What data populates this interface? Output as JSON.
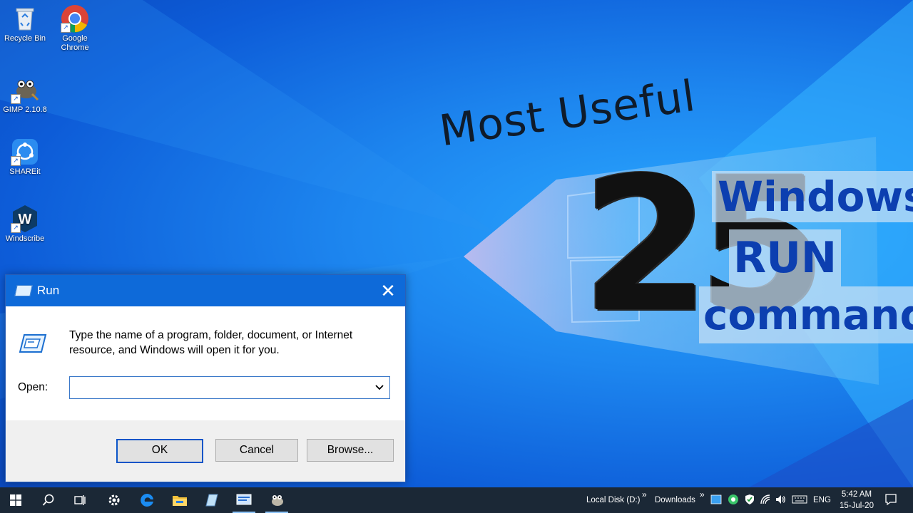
{
  "desktop": {
    "icons": [
      {
        "label": "Recycle Bin"
      },
      {
        "label": "Google Chrome"
      },
      {
        "label": "GIMP 2.10.8"
      },
      {
        "label": "SHAREit"
      },
      {
        "label": "Windscribe"
      }
    ]
  },
  "thumbnail": {
    "headline": "Most Useful",
    "number": "25",
    "line1": "Windows",
    "line2": "RUN",
    "line3": "commands"
  },
  "run_dialog": {
    "title": "Run",
    "close_glyph": "✕",
    "description": "Type the name of a program, folder, document, or Internet resource, and Windows will open it for you.",
    "open_label": "Open:",
    "open_value": "",
    "ok_label": "OK",
    "cancel_label": "Cancel",
    "browse_label": "Browse..."
  },
  "taskbar": {
    "pinned": [
      "windows-start-icon",
      "search-icon",
      "task-view-icon",
      "settings-gear-icon",
      "edge-icon",
      "file-explorer-icon",
      "notepad-icon",
      "run-app-icon",
      "gimp-icon"
    ],
    "toolbar_local_disk": "Local Disk (D:)",
    "toolbar_downloads": "Downloads",
    "chevron": "»",
    "language": "ENG",
    "time": "5:42 AM",
    "date": "15-Jul-20"
  },
  "colors": {
    "taskbar_bg": "#1b2836",
    "titlebar": "#0e6ad9",
    "thumbnail_text": "#0c3fb0"
  }
}
